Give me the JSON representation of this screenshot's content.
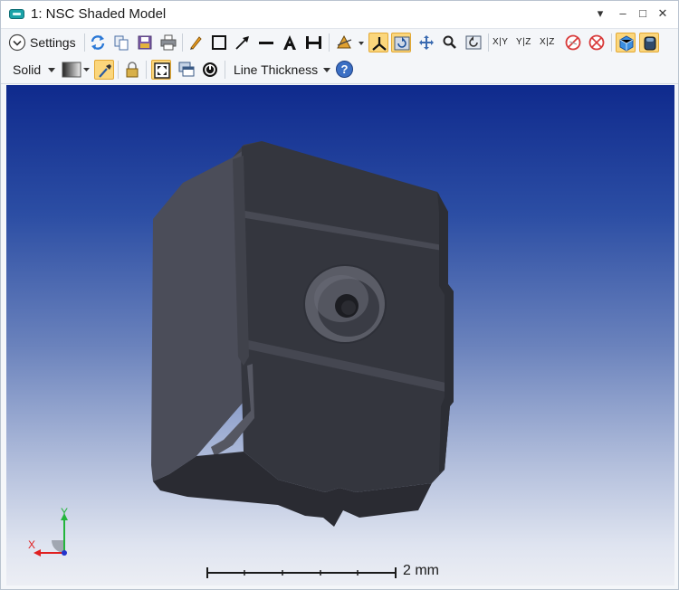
{
  "window": {
    "title": "1: NSC Shaded Model",
    "controls": {
      "menu": "▾",
      "minimize": "–",
      "maximize": "□",
      "close": "✕"
    }
  },
  "toolbar_row1": {
    "settings_label": "Settings",
    "axis_labels": [
      "X|Y",
      "Y|Z",
      "X|Z"
    ]
  },
  "toolbar_row2": {
    "render_mode": "Solid",
    "line_thickness_label": "Line Thickness",
    "help_glyph": "?"
  },
  "viewport": {
    "background_top": "#0f2a8d",
    "background_bottom": "#eceef4",
    "model_color": "#33353d"
  },
  "axes": {
    "x_label": "X",
    "y_label": "Y",
    "x_color": "#e02020",
    "y_color": "#22b53b",
    "z_color": "#2233cc"
  },
  "scale_bar": {
    "label": "2 mm"
  }
}
